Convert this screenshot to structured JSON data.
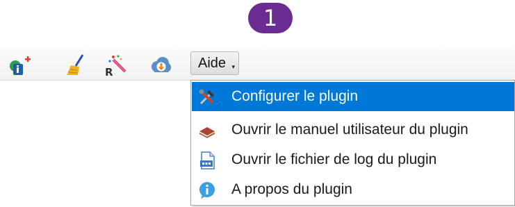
{
  "step_badge": "1",
  "toolbar": {
    "icons": [
      {
        "name": "info-add-icon"
      },
      {
        "name": "broom-icon"
      },
      {
        "name": "r-magic-wand-icon"
      },
      {
        "name": "cloud-download-icon"
      }
    ],
    "menu_button_label": "Aide"
  },
  "menu": {
    "items": [
      {
        "label": "Configurer le plugin",
        "icon": "hammer-wrench-icon",
        "selected": true
      },
      {
        "label": "Ouvrir le manuel utilisateur du plugin",
        "icon": "book-icon",
        "selected": false
      },
      {
        "label": "Ouvrir le fichier de log du plugin",
        "icon": "log-file-icon",
        "selected": false
      },
      {
        "label": "A propos du plugin",
        "icon": "info-icon",
        "selected": false
      }
    ]
  },
  "colors": {
    "badge": "#6a2c91",
    "selection": "#0078d7"
  }
}
